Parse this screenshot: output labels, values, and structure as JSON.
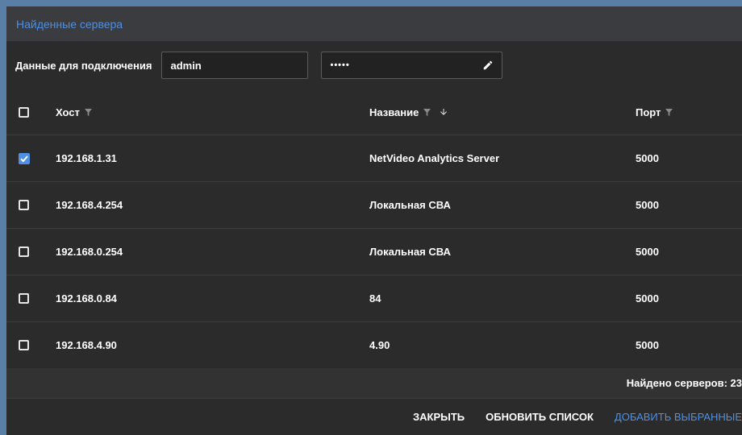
{
  "title": "Найденные сервера",
  "connection": {
    "label": "Данные для подключения",
    "login_value": "admin",
    "password_value": "•••••",
    "edit_icon": "pencil-icon"
  },
  "table": {
    "columns": [
      "Хост",
      "Название",
      "Порт"
    ],
    "rows": [
      {
        "checked": true,
        "host": "192.168.1.31",
        "name": "NetVideo Analytics Server",
        "port": "5000"
      },
      {
        "checked": false,
        "host": "192.168.4.254",
        "name": "Локальная СВА",
        "port": "5000"
      },
      {
        "checked": false,
        "host": "192.168.0.254",
        "name": "Локальная СВА",
        "port": "5000"
      },
      {
        "checked": false,
        "host": "192.168.0.84",
        "name": "84",
        "port": "5000"
      },
      {
        "checked": false,
        "host": "192.168.4.90",
        "name": "4.90",
        "port": "5000"
      }
    ]
  },
  "footer": {
    "found_text": "Найдено серверов: 23"
  },
  "actions": {
    "close": "ЗАКРЫТЬ",
    "refresh": "ОБНОВИТЬ СПИСОК",
    "add": "ДОБАВИТЬ ВЫБРАННЫЕ"
  },
  "colors": {
    "accent": "#4d90e6",
    "background": "#2b2b2b",
    "titlebar": "#3a3c40"
  }
}
